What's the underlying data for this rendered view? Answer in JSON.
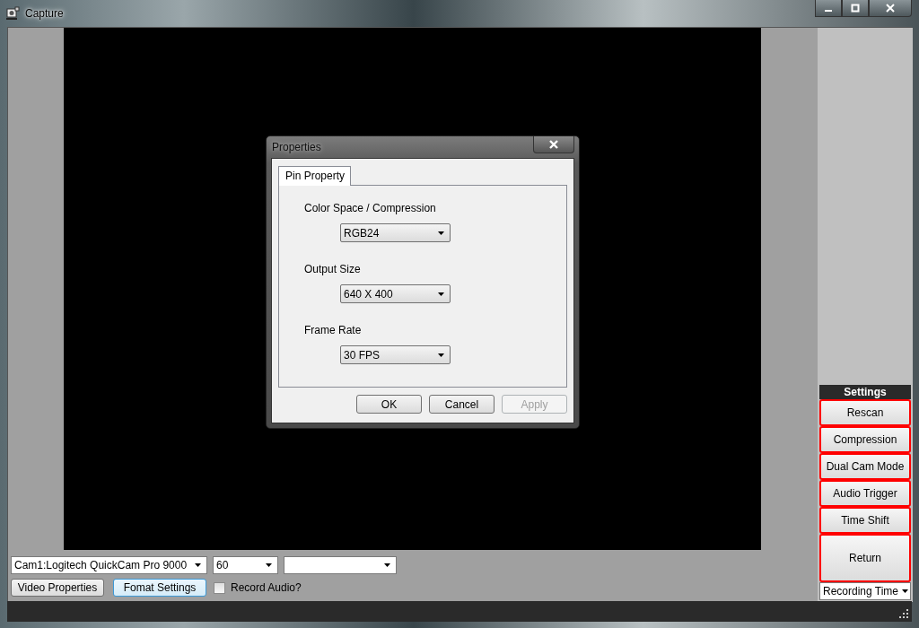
{
  "window": {
    "title": "Capture"
  },
  "toolbar": {
    "camera": {
      "value": "Cam1:Logitech QuickCam Pro 9000"
    },
    "rate": {
      "value": "60"
    },
    "buttons": [
      {
        "label": "Video Properties",
        "focused": false
      },
      {
        "label": "Fomat Settings",
        "focused": true
      }
    ],
    "record_audio": {
      "label": "Record Audio?",
      "checked": false
    }
  },
  "settings_panel": {
    "title": "Settings",
    "buttons": [
      {
        "label": "Rescan",
        "kind": "normal"
      },
      {
        "label": "Compression",
        "kind": "normal"
      },
      {
        "label": "Dual Cam Mode",
        "kind": "normal"
      },
      {
        "label": "Audio Trigger",
        "kind": "normal"
      },
      {
        "label": "Time Shift",
        "kind": "normal"
      },
      {
        "label": "Return",
        "kind": "tall"
      }
    ],
    "mode_select": {
      "value": "Recording Time"
    }
  },
  "dialog": {
    "title": "Properties",
    "tabs": [
      {
        "label": "Pin Property",
        "selected": true
      }
    ],
    "fields": [
      {
        "label": "Color Space / Compression",
        "value": "RGB24"
      },
      {
        "label": "Output Size",
        "value": "640 X 400"
      },
      {
        "label": "Frame Rate",
        "value": "30 FPS"
      }
    ],
    "buttons": [
      {
        "label": "OK",
        "disabled": false
      },
      {
        "label": "Cancel",
        "disabled": false
      },
      {
        "label": "Apply",
        "disabled": true
      }
    ]
  }
}
